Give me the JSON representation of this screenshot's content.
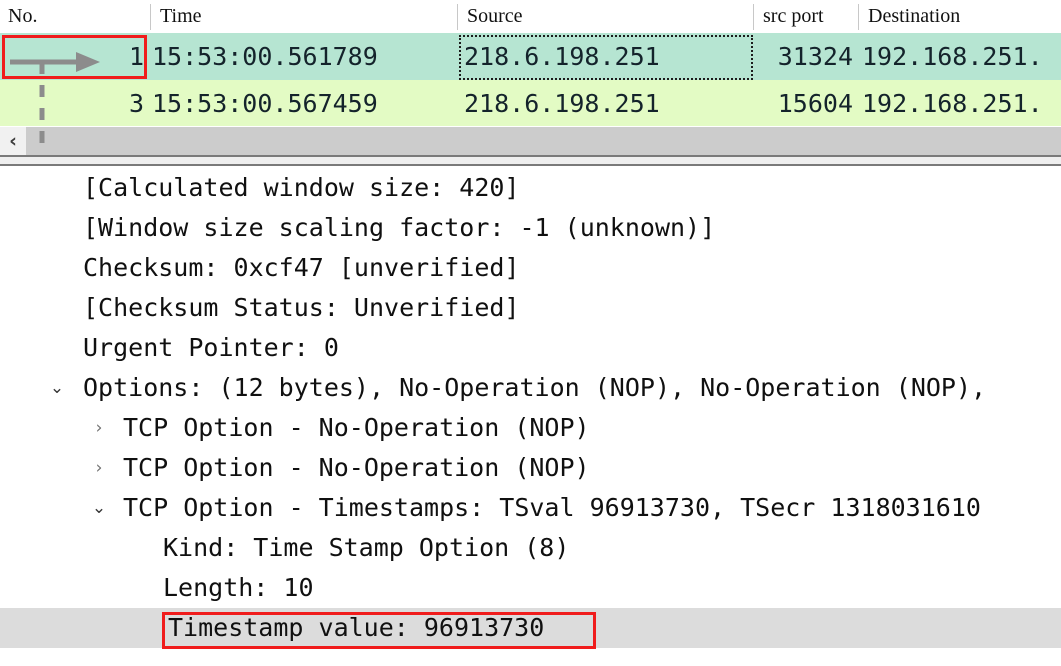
{
  "packet_list": {
    "columns": [
      {
        "label": "No."
      },
      {
        "label": "Time"
      },
      {
        "label": "Source"
      },
      {
        "label": "src port"
      },
      {
        "label": "Destination"
      }
    ],
    "rows": [
      {
        "no": "1",
        "time": "15:53:00.561789",
        "source": "218.6.198.251",
        "src_port": "31324",
        "destination": "192.168.251.",
        "state": "selected"
      },
      {
        "no": "3",
        "time": "15:53:00.567459",
        "source": "218.6.198.251",
        "src_port": "15604",
        "destination": "192.168.251.",
        "state": "normal"
      }
    ],
    "scrollbar": {
      "left_button_icon": "chevron-left-icon",
      "left_button_glyph": "‹"
    }
  },
  "detail_tree": {
    "rows": [
      {
        "indent": 0,
        "twisty": "none",
        "glyph": "",
        "text": "[Calculated window size: 420]"
      },
      {
        "indent": 0,
        "twisty": "none",
        "glyph": "",
        "text": "[Window size scaling factor: -1 (unknown)]"
      },
      {
        "indent": 0,
        "twisty": "none",
        "glyph": "",
        "text": "Checksum: 0xcf47 [unverified]"
      },
      {
        "indent": 0,
        "twisty": "none",
        "glyph": "",
        "text": "[Checksum Status: Unverified]"
      },
      {
        "indent": 0,
        "twisty": "none",
        "glyph": "",
        "text": "Urgent Pointer: 0"
      },
      {
        "indent": 0,
        "twisty": "expanded",
        "glyph": "⌄",
        "text": "Options: (12 bytes), No-Operation (NOP), No-Operation (NOP),"
      },
      {
        "indent": 1,
        "twisty": "collapsed",
        "glyph": "›",
        "text": "TCP Option - No-Operation (NOP)"
      },
      {
        "indent": 1,
        "twisty": "collapsed",
        "glyph": "›",
        "text": "TCP Option - No-Operation (NOP)"
      },
      {
        "indent": 1,
        "twisty": "expanded",
        "glyph": "⌄",
        "text": "TCP Option - Timestamps: TSval 96913730, TSecr 1318031610"
      },
      {
        "indent": 2,
        "twisty": "none",
        "glyph": "",
        "text": "Kind: Time Stamp Option (8)"
      },
      {
        "indent": 2,
        "twisty": "none",
        "glyph": "",
        "text": "Length: 10"
      },
      {
        "indent": 2,
        "twisty": "none",
        "glyph": "",
        "text": "Timestamp value: 96913730",
        "selected": true
      }
    ]
  },
  "annotations": {
    "no_cell_box_label": "highlight-packet-number",
    "timestamp_box_label": "highlight-timestamp-value",
    "arrow_label": "pointer-arrow",
    "red_color": "#f01c1c",
    "arrow_color": "#8c8c8c"
  }
}
